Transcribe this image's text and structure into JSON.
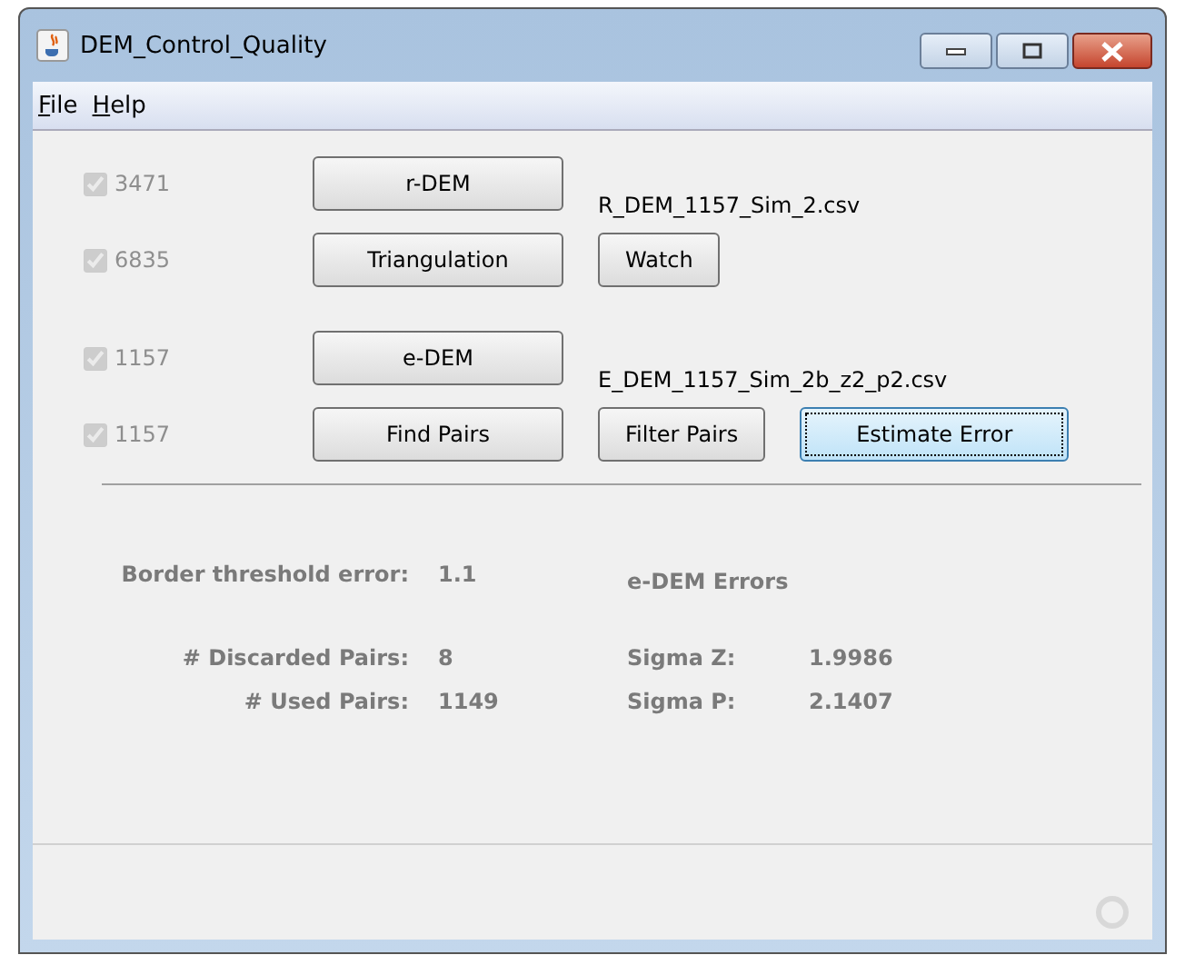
{
  "window": {
    "title": "DEM_Control_Quality"
  },
  "menu": [
    {
      "label": "File"
    },
    {
      "label": "Help"
    }
  ],
  "rows": [
    {
      "checked": true,
      "disabled": true,
      "count": "3471",
      "buttons": [
        {
          "label": "r-DEM",
          "focused": false
        }
      ],
      "file": "R_DEM_1157_Sim_2.csv"
    },
    {
      "checked": true,
      "disabled": true,
      "count": "6835",
      "buttons": [
        {
          "label": "Triangulation",
          "focused": false
        },
        {
          "label": "Watch",
          "focused": false
        }
      ]
    },
    {
      "checked": true,
      "disabled": true,
      "count": "1157",
      "buttons": [
        {
          "label": "e-DEM",
          "focused": false
        }
      ],
      "file": "E_DEM_1157_Sim_2b_z2_p2.csv"
    },
    {
      "checked": true,
      "disabled": true,
      "count": "1157",
      "buttons": [
        {
          "label": "Find Pairs",
          "focused": false
        },
        {
          "label": "Filter Pairs",
          "focused": false
        },
        {
          "label": "Estimate Error",
          "focused": true
        }
      ]
    }
  ],
  "stats": {
    "threshold_label": "Border threshold error:",
    "threshold_value": "1.1",
    "errors_heading": "e-DEM Errors",
    "discarded_label": "# Discarded Pairs:",
    "discarded_value": "8",
    "sigma_z_label": "Sigma Z:",
    "sigma_z_value": "1.9986",
    "used_label": "# Used Pairs:",
    "used_value": "1149",
    "sigma_p_label": "Sigma P:",
    "sigma_p_value": "2.1407"
  }
}
